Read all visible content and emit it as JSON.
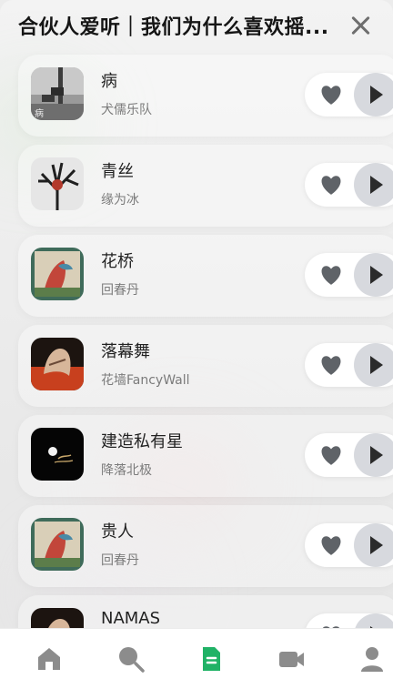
{
  "header": {
    "title": "合伙人爱听｜我们为什么喜欢摇..."
  },
  "songs": [
    {
      "title": "病",
      "artist": "犬儒乐队",
      "cover_icon": "camera-pole-cover"
    },
    {
      "title": "青丝",
      "artist": "缘为冰",
      "cover_icon": "tree-portrait-cover"
    },
    {
      "title": "花桥",
      "artist": "回春丹",
      "cover_icon": "bird-painting-cover"
    },
    {
      "title": "落幕舞",
      "artist": "花墙FancyWall",
      "cover_icon": "hands-fire-cover"
    },
    {
      "title": "建造私有星",
      "artist": "降落北极",
      "cover_icon": "planet-black-cover"
    },
    {
      "title": "贵人",
      "artist": "回春丹",
      "cover_icon": "bird-painting-cover"
    },
    {
      "title": "NAMAS",
      "artist": "",
      "cover_icon": "hands-fire-cover"
    }
  ],
  "tabbar": {
    "items": [
      "home-icon",
      "search-icon",
      "document-icon",
      "video-icon",
      "profile-icon"
    ],
    "active": "document-icon",
    "active_color": "#20b266",
    "inactive_color": "#8c8c8c"
  }
}
